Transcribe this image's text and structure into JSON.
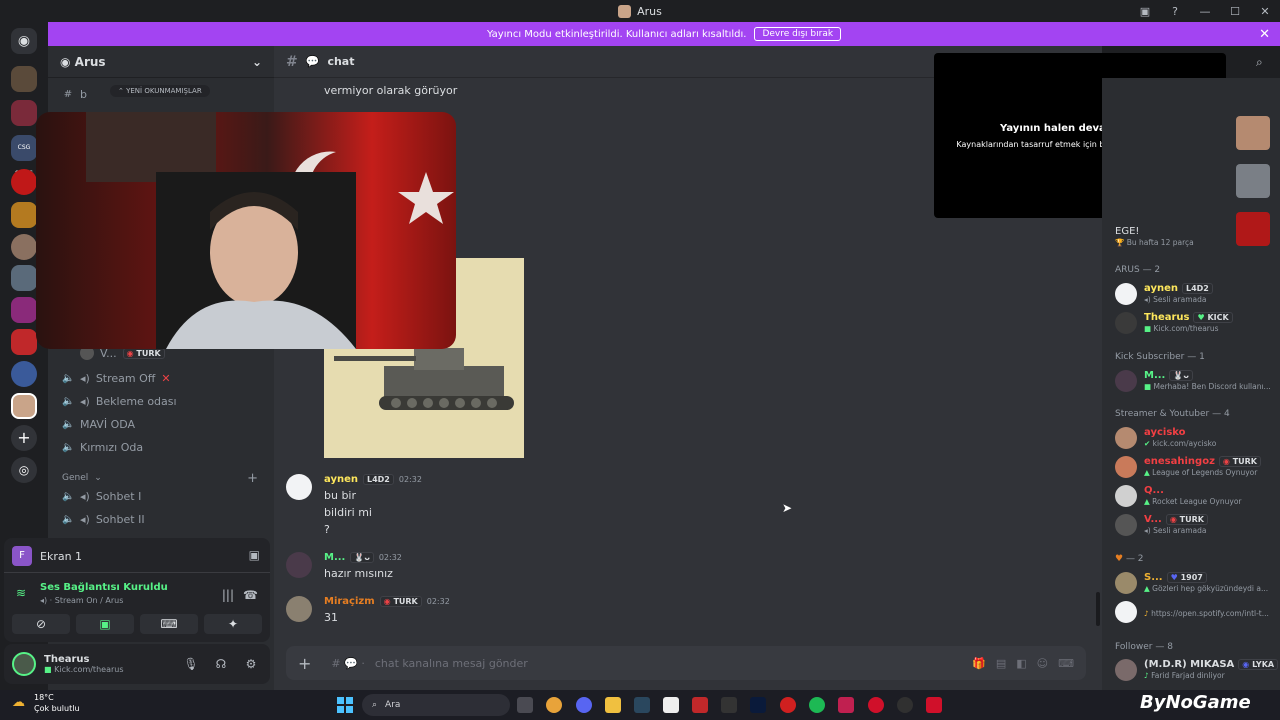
{
  "window": {
    "title": "Arus"
  },
  "banner": {
    "text": "Yayıncı Modu etkinleştirildi. Kullanıcı adları kısaltıldı.",
    "button": "Devre dışı bırak"
  },
  "server": {
    "name": "Arus"
  },
  "sidebar": {
    "unread_label": "YENİ OKUNMAMIŞLAR",
    "top_channel": "b",
    "voice_user": "V...",
    "voice_user_badge": "TURK",
    "channels": [
      "Stream Off",
      "Bekleme odası",
      "MAVİ ODA",
      "Kırmızı Oda"
    ],
    "category": "Genel",
    "channels2": [
      "Sohbet I",
      "Sohbet II"
    ]
  },
  "panel": {
    "screen_title": "Ekran 1",
    "status": "Ses Bağlantısı Kuruldu",
    "sub": "Stream On / Arus"
  },
  "user": {
    "name": "Thearus",
    "status": "Kick.com/thearus"
  },
  "chat": {
    "channel": "chat",
    "top_text": "vermiyor olarak görüyor",
    "messages": [
      {
        "author": "aynen",
        "badge": "L4D2",
        "time": "02:32",
        "lines": [
          "bu bir",
          "bildiri mi",
          "?"
        ]
      },
      {
        "author": "M...",
        "badge": "",
        "time": "02:32",
        "lines": [
          "hazır mısınız"
        ]
      },
      {
        "author": "Miraçizm",
        "badge": "TURK",
        "time": "02:32",
        "lines": [
          "31"
        ]
      }
    ],
    "placeholder": "chat kanalına mesaj gönder"
  },
  "stream_notice": {
    "title": "Yayının halen devam ediyor!",
    "body": "Kaynaklarından tasarruf etmek için bu önizlemeyi duraklattık."
  },
  "members": {
    "top": {
      "name": "EGE!",
      "status": "Bu hafta 12 parça"
    },
    "groups": [
      {
        "title": "ARUS — 2",
        "items": [
          {
            "name": "aynen",
            "badge": "L4D2",
            "status": "Sesli aramada",
            "color": "#fee75c"
          },
          {
            "name": "Thearus",
            "badge": "KICK",
            "status": "Kick.com/thearus",
            "color": "#fee75c"
          }
        ]
      },
      {
        "title": "Kick Subscriber — 1",
        "items": [
          {
            "name": "M...",
            "badge": "",
            "status": "Merhaba! Ben Discord kullanı...",
            "color": "#57f287"
          }
        ]
      },
      {
        "title": "Streamer & Youtuber — 4",
        "items": [
          {
            "name": "aycisko",
            "badge": "",
            "status": "kick.com/aycisko",
            "color": "#f23f43"
          },
          {
            "name": "enesahingoz",
            "badge": "TURK",
            "status": "League of Legends Oynuyor",
            "color": "#f23f43"
          },
          {
            "name": "Q...",
            "badge": "",
            "status": "Rocket League Oynuyor",
            "color": "#f23f43"
          },
          {
            "name": "V...",
            "badge": "TURK",
            "status": "Sesli aramada",
            "color": "#f23f43"
          }
        ]
      },
      {
        "title": "— 2",
        "items": [
          {
            "name": "S...",
            "badge": "1907",
            "status": "Gözleri hep gökyüzündeydi a...",
            "color": "#f0b232"
          },
          {
            "name": "",
            "badge": "",
            "status": "https://open.spotify.com/intl-t...",
            "color": "#f0b232"
          }
        ]
      },
      {
        "title": "Follower — 8",
        "items": [
          {
            "name": "(M.D.R) MIKASA",
            "badge": "LYKA",
            "status": "Farid Farjad dinliyor",
            "color": "#dbdee1"
          }
        ]
      }
    ]
  },
  "taskbar": {
    "weather_temp": "18°C",
    "weather_desc": "Çok bulutlu",
    "search": "Ara",
    "watermark": "ByNoGame"
  }
}
